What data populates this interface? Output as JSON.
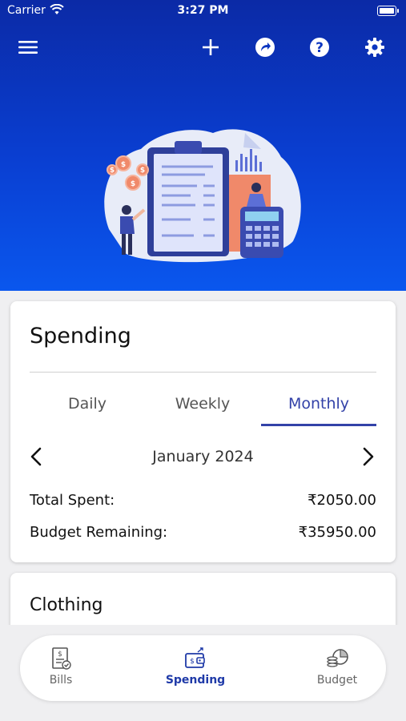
{
  "status_bar": {
    "carrier": "Carrier",
    "time": "3:27 PM"
  },
  "toolbar": {
    "icons": [
      "menu-icon",
      "plus-icon",
      "share-icon",
      "help-icon",
      "gear-icon"
    ]
  },
  "spending_card": {
    "title": "Spending",
    "tabs": [
      "Daily",
      "Weekly",
      "Monthly"
    ],
    "active_tab": "Monthly",
    "period": "January 2024",
    "total_spent_label": "Total Spent:",
    "total_spent_value": "₹2050.00",
    "budget_remaining_label": "Budget Remaining:",
    "budget_remaining_value": "₹35950.00"
  },
  "category_card": {
    "title": "Clothing"
  },
  "tab_bar": {
    "items": [
      {
        "label": "Bills",
        "icon": "bill-icon"
      },
      {
        "label": "Spending",
        "icon": "wallet-icon"
      },
      {
        "label": "Budget",
        "icon": "budget-icon"
      }
    ],
    "active": "Spending"
  },
  "colors": {
    "header_top": "#0b2aa6",
    "header_bottom": "#0a57ee",
    "accent": "#3342a8"
  }
}
